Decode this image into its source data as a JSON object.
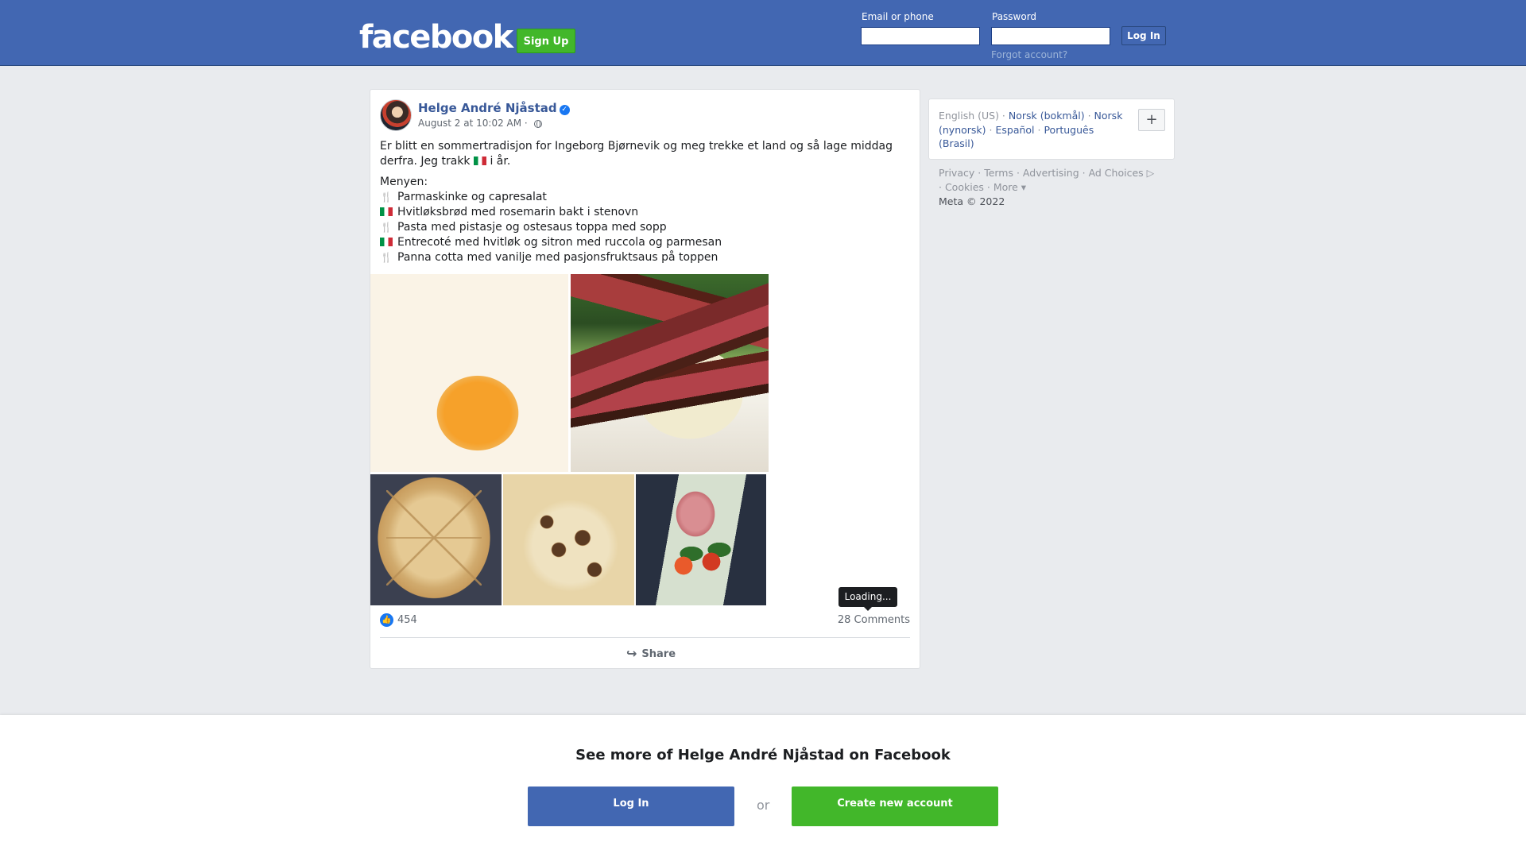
{
  "header": {
    "logo": "facebook",
    "signup_label": "Sign Up",
    "email_label": "Email or phone",
    "password_label": "Password",
    "email_value": "",
    "password_value": "",
    "login_label": "Log In",
    "forgot_label": "Forgot account?",
    "colors": {
      "bar": "#4267b2",
      "signup": "#42b72a"
    }
  },
  "post": {
    "author": "Helge André Njåstad",
    "verified_icon": "check-badge-icon",
    "timestamp": "August 2 at 10:02 AM",
    "privacy_sep": "·",
    "intro_a": "Er blitt en sommertradisjon for Ingeborg Bjørnevik og meg trekke et land og så lage middag derfra. Jeg trakk",
    "intro_b": "i år.",
    "menu_title": "Menyen:",
    "menu": [
      {
        "icon": "fork-knife-icon",
        "text": "Parmaskinke og capresalat"
      },
      {
        "icon": "italy-flag-icon",
        "text": "Hvitløksbrød med rosemarin bakt i stenovn"
      },
      {
        "icon": "fork-knife-icon",
        "text": "Pasta med pistasje og ostesaus toppa med sopp"
      },
      {
        "icon": "italy-flag-icon",
        "text": "Entrecoté med hvitløk og sitron med ruccola og parmesan"
      },
      {
        "icon": "fork-knife-icon",
        "text": "Panna cotta med vanilje med pasjonsfruktsaus på toppen"
      }
    ],
    "photos": [
      "panna cotta",
      "entrecote",
      "garlic bread",
      "pasta with mushrooms",
      "prosciutto and caprese"
    ],
    "tooltip": "Loading...",
    "likes": "454",
    "comments": "28 Comments",
    "share_label": "Share"
  },
  "sidebar": {
    "current_language": "English (US)",
    "languages": [
      "Norsk (bokmål)",
      "Norsk (nynorsk)",
      "Español",
      "Português (Brasil)"
    ],
    "add_label": "+",
    "footer": [
      "Privacy",
      "Terms",
      "Advertising",
      "Ad Choices",
      "Cookies",
      "More"
    ],
    "copyright": "Meta © 2022"
  },
  "bottom": {
    "title": "See more of Helge André Njåstad on Facebook",
    "login_label": "Log In",
    "or_label": "or",
    "create_label": "Create new account"
  }
}
